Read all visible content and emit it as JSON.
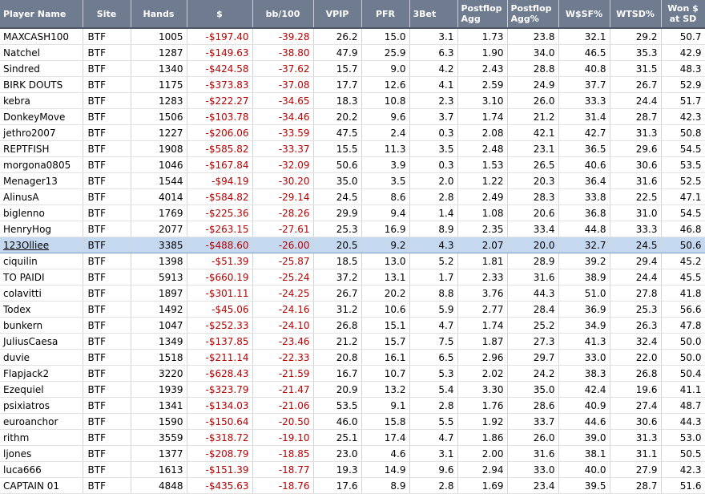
{
  "columns": [
    "Player Name",
    "Site",
    "Hands",
    "$",
    "bb/100",
    "VPIP",
    "PFR",
    "3Bet",
    "Postflop Agg",
    "Postflop Agg%",
    "W$SF%",
    "WTSD%",
    "Won $ at SD"
  ],
  "selected_row_index": 13,
  "rows": [
    [
      "MAXCASH100",
      "BTF",
      "1005",
      "-$197.40",
      "-39.28",
      "26.2",
      "15.0",
      "3.1",
      "1.73",
      "23.8",
      "32.1",
      "29.2",
      "50.7"
    ],
    [
      "Natchel",
      "BTF",
      "1287",
      "-$149.63",
      "-38.80",
      "47.9",
      "25.9",
      "6.3",
      "1.90",
      "34.0",
      "46.5",
      "35.3",
      "42.9"
    ],
    [
      "Sindred",
      "BTF",
      "1340",
      "-$424.58",
      "-37.62",
      "15.7",
      "9.0",
      "4.2",
      "2.43",
      "28.8",
      "40.8",
      "31.5",
      "48.3"
    ],
    [
      "BIRK DOUTS",
      "BTF",
      "1175",
      "-$373.83",
      "-37.08",
      "17.7",
      "12.6",
      "4.1",
      "2.59",
      "24.9",
      "37.7",
      "26.7",
      "52.9"
    ],
    [
      "kebra",
      "BTF",
      "1283",
      "-$222.27",
      "-34.65",
      "18.3",
      "10.8",
      "2.3",
      "3.10",
      "26.0",
      "33.3",
      "24.4",
      "51.7"
    ],
    [
      "DonkeyMove",
      "BTF",
      "1506",
      "-$103.78",
      "-34.46",
      "20.2",
      "9.6",
      "3.7",
      "1.74",
      "21.2",
      "31.4",
      "28.7",
      "42.3"
    ],
    [
      "jethro2007",
      "BTF",
      "1227",
      "-$206.06",
      "-33.59",
      "47.5",
      "2.4",
      "0.3",
      "2.08",
      "42.1",
      "42.7",
      "31.3",
      "50.8"
    ],
    [
      "REPTFISH",
      "BTF",
      "1908",
      "-$585.82",
      "-33.37",
      "15.5",
      "11.3",
      "3.5",
      "2.48",
      "23.1",
      "36.5",
      "29.6",
      "54.5"
    ],
    [
      "morgona0805",
      "BTF",
      "1046",
      "-$167.84",
      "-32.09",
      "50.6",
      "3.9",
      "0.3",
      "1.53",
      "26.5",
      "40.6",
      "30.6",
      "53.5"
    ],
    [
      "Menager13",
      "BTF",
      "1544",
      "-$94.19",
      "-30.20",
      "35.0",
      "3.5",
      "2.0",
      "1.22",
      "20.3",
      "36.4",
      "31.6",
      "52.5"
    ],
    [
      "AlinusA",
      "BTF",
      "4014",
      "-$584.82",
      "-29.14",
      "24.5",
      "8.6",
      "2.8",
      "2.49",
      "28.3",
      "33.8",
      "22.5",
      "47.1"
    ],
    [
      "biglenno",
      "BTF",
      "1769",
      "-$225.36",
      "-28.26",
      "29.9",
      "9.4",
      "1.4",
      "1.08",
      "20.6",
      "36.8",
      "31.0",
      "54.5"
    ],
    [
      "HenryHog",
      "BTF",
      "2077",
      "-$263.15",
      "-27.61",
      "25.3",
      "16.9",
      "8.9",
      "2.35",
      "33.4",
      "44.8",
      "33.3",
      "46.8"
    ],
    [
      "123Olliee",
      "BTF",
      "3385",
      "-$488.60",
      "-26.00",
      "20.5",
      "9.2",
      "4.3",
      "2.07",
      "20.0",
      "32.7",
      "24.5",
      "50.6"
    ],
    [
      "ciquilin",
      "BTF",
      "1398",
      "-$51.39",
      "-25.87",
      "18.5",
      "13.0",
      "5.2",
      "1.81",
      "28.9",
      "39.2",
      "29.4",
      "45.2"
    ],
    [
      "TO PAIDI",
      "BTF",
      "5913",
      "-$660.19",
      "-25.24",
      "37.2",
      "13.1",
      "1.7",
      "2.33",
      "31.6",
      "38.9",
      "24.4",
      "45.5"
    ],
    [
      "colavitti",
      "BTF",
      "1897",
      "-$301.11",
      "-24.25",
      "26.7",
      "20.2",
      "8.8",
      "3.76",
      "44.3",
      "51.0",
      "27.8",
      "41.8"
    ],
    [
      "Todex",
      "BTF",
      "1492",
      "-$45.06",
      "-24.16",
      "31.2",
      "10.6",
      "5.9",
      "2.77",
      "28.4",
      "36.9",
      "25.3",
      "56.6"
    ],
    [
      "bunkern",
      "BTF",
      "1047",
      "-$252.33",
      "-24.10",
      "26.8",
      "15.1",
      "4.7",
      "1.74",
      "25.2",
      "34.9",
      "26.3",
      "47.8"
    ],
    [
      "JuliusCaesa",
      "BTF",
      "1349",
      "-$137.85",
      "-23.46",
      "21.2",
      "15.7",
      "7.5",
      "1.87",
      "27.3",
      "41.3",
      "32.4",
      "50.0"
    ],
    [
      "duvie",
      "BTF",
      "1518",
      "-$211.14",
      "-22.33",
      "20.8",
      "16.1",
      "6.5",
      "2.96",
      "29.7",
      "33.0",
      "22.0",
      "50.0"
    ],
    [
      "Flapjack2",
      "BTF",
      "3220",
      "-$628.43",
      "-21.59",
      "16.7",
      "10.7",
      "5.3",
      "2.02",
      "24.2",
      "38.3",
      "26.8",
      "50.4"
    ],
    [
      "Ezequiel",
      "BTF",
      "1939",
      "-$323.79",
      "-21.47",
      "20.9",
      "13.2",
      "5.4",
      "3.30",
      "35.0",
      "42.4",
      "19.6",
      "41.1"
    ],
    [
      "psixiatros",
      "BTF",
      "1341",
      "-$134.03",
      "-21.06",
      "53.5",
      "9.1",
      "2.8",
      "1.76",
      "28.6",
      "40.9",
      "27.4",
      "48.7"
    ],
    [
      "euroanchor",
      "BTF",
      "1590",
      "-$150.64",
      "-20.50",
      "46.0",
      "15.8",
      "5.5",
      "1.92",
      "33.7",
      "44.6",
      "30.6",
      "44.3"
    ],
    [
      "rithm",
      "BTF",
      "3559",
      "-$318.72",
      "-19.10",
      "25.1",
      "17.4",
      "4.7",
      "1.86",
      "26.0",
      "39.0",
      "31.3",
      "53.0"
    ],
    [
      "ljones",
      "BTF",
      "1377",
      "-$208.79",
      "-18.85",
      "23.0",
      "4.6",
      "3.1",
      "2.00",
      "31.6",
      "38.1",
      "31.1",
      "50.5"
    ],
    [
      "luca666",
      "BTF",
      "1613",
      "-$151.39",
      "-18.77",
      "19.3",
      "14.9",
      "9.6",
      "2.94",
      "33.0",
      "40.0",
      "27.9",
      "42.3"
    ],
    [
      "CAPTAIN 01",
      "BTF",
      "4848",
      "-$435.63",
      "-18.76",
      "17.6",
      "8.9",
      "2.8",
      "1.69",
      "23.4",
      "39.5",
      "28.7",
      "51.6"
    ]
  ]
}
